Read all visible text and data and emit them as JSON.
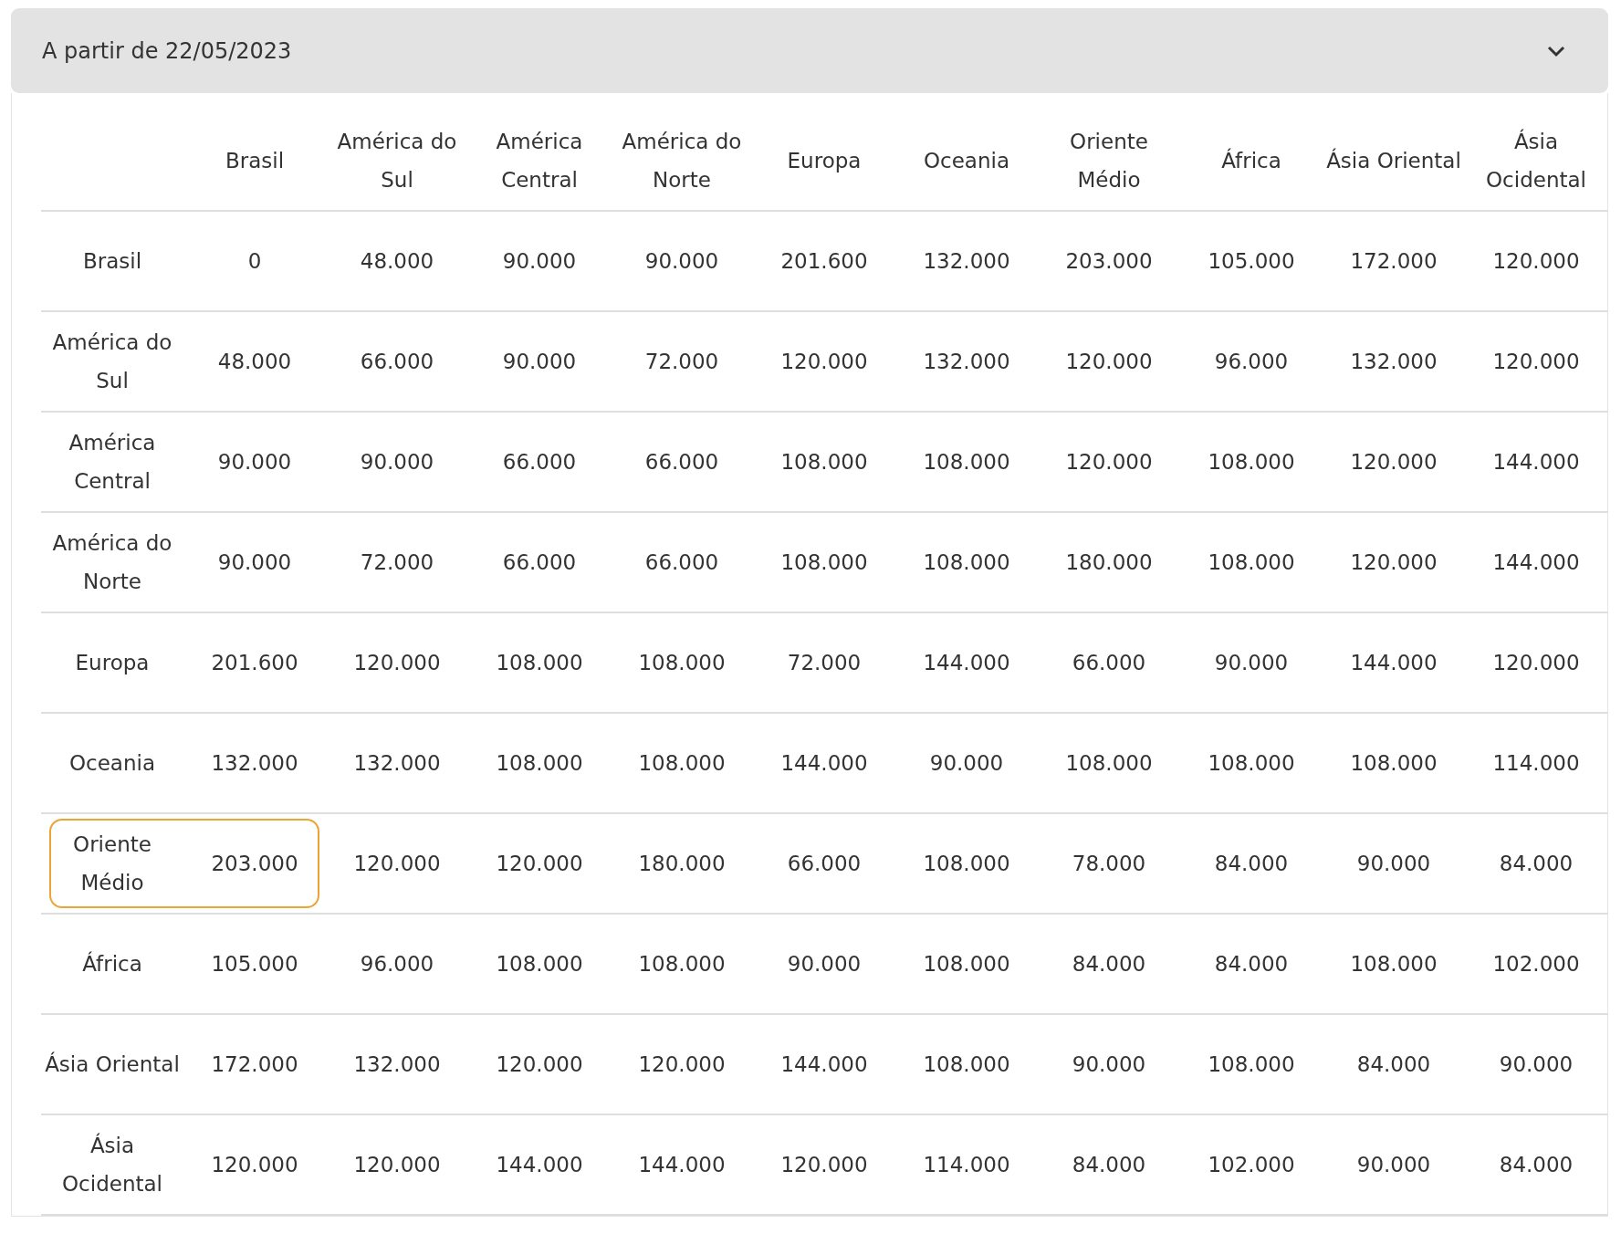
{
  "accordion": {
    "title": "A partir de 22/05/2023",
    "expanded": true
  },
  "table": {
    "columns": [
      "Brasil",
      "América do Sul",
      "América Central",
      "América do Norte",
      "Europa",
      "Oceania",
      "Oriente Médio",
      "África",
      "Ásia Oriental",
      "Ásia Ocidental"
    ],
    "rows": [
      {
        "label": "Brasil",
        "highlighted": false,
        "cells": [
          "0",
          "48.000",
          "90.000",
          "90.000",
          "201.600",
          "132.000",
          "203.000",
          "105.000",
          "172.000",
          "120.000"
        ]
      },
      {
        "label": "América do Sul",
        "highlighted": false,
        "cells": [
          "48.000",
          "66.000",
          "90.000",
          "72.000",
          "120.000",
          "132.000",
          "120.000",
          "96.000",
          "132.000",
          "120.000"
        ]
      },
      {
        "label": "América Central",
        "highlighted": false,
        "cells": [
          "90.000",
          "90.000",
          "66.000",
          "66.000",
          "108.000",
          "108.000",
          "120.000",
          "108.000",
          "120.000",
          "144.000"
        ]
      },
      {
        "label": "América do Norte",
        "highlighted": false,
        "cells": [
          "90.000",
          "72.000",
          "66.000",
          "66.000",
          "108.000",
          "108.000",
          "180.000",
          "108.000",
          "120.000",
          "144.000"
        ]
      },
      {
        "label": "Europa",
        "highlighted": false,
        "cells": [
          "201.600",
          "120.000",
          "108.000",
          "108.000",
          "72.000",
          "144.000",
          "66.000",
          "90.000",
          "144.000",
          "120.000"
        ]
      },
      {
        "label": "Oceania",
        "highlighted": false,
        "cells": [
          "132.000",
          "132.000",
          "108.000",
          "108.000",
          "144.000",
          "90.000",
          "108.000",
          "108.000",
          "108.000",
          "114.000"
        ]
      },
      {
        "label": "Oriente Médio",
        "highlighted": true,
        "cells": [
          "203.000",
          "120.000",
          "120.000",
          "180.000",
          "66.000",
          "108.000",
          "78.000",
          "84.000",
          "90.000",
          "84.000"
        ]
      },
      {
        "label": "África",
        "highlighted": false,
        "cells": [
          "105.000",
          "96.000",
          "108.000",
          "108.000",
          "90.000",
          "108.000",
          "84.000",
          "84.000",
          "108.000",
          "102.000"
        ]
      },
      {
        "label": "Ásia Oriental",
        "highlighted": false,
        "cells": [
          "172.000",
          "132.000",
          "120.000",
          "120.000",
          "144.000",
          "108.000",
          "90.000",
          "108.000",
          "84.000",
          "90.000"
        ]
      },
      {
        "label": "Ásia Ocidental",
        "highlighted": false,
        "cells": [
          "120.000",
          "120.000",
          "144.000",
          "144.000",
          "120.000",
          "114.000",
          "84.000",
          "102.000",
          "90.000",
          "84.000"
        ]
      }
    ]
  }
}
